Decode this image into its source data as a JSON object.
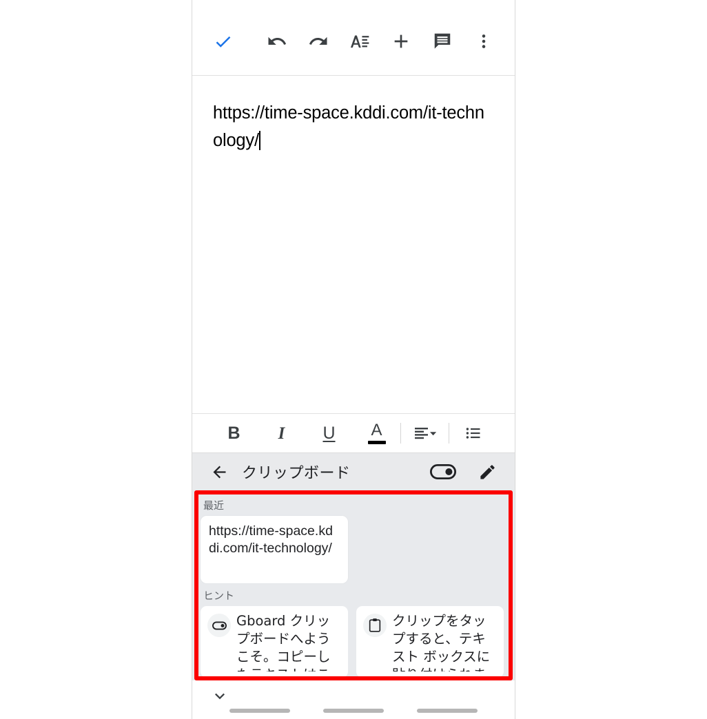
{
  "app": {
    "name": "Google Docs mobile editor with Gboard clipboard"
  },
  "top_toolbar": {
    "items": [
      {
        "name": "done-check",
        "label": "Done",
        "icon": "check-icon",
        "color": "#1a73e8"
      },
      {
        "name": "undo",
        "label": "Undo",
        "icon": "undo-icon"
      },
      {
        "name": "redo",
        "label": "Redo",
        "icon": "redo-icon"
      },
      {
        "name": "format",
        "label": "Format text",
        "icon": "text-format-icon"
      },
      {
        "name": "insert",
        "label": "Insert",
        "icon": "plus-icon"
      },
      {
        "name": "comment",
        "label": "Comment",
        "icon": "comment-icon"
      },
      {
        "name": "more",
        "label": "More options",
        "icon": "more-vertical-icon"
      }
    ]
  },
  "document": {
    "text": "https://time-space.kddi.com/it-technology/",
    "caret_visible": true
  },
  "format_toolbar": {
    "bold_label": "B",
    "italic_label": "I",
    "underline_label": "U",
    "text_color_label": "A",
    "align_label": "align-left",
    "list_label": "bulleted-list"
  },
  "clipboard": {
    "header": {
      "back_label": "back",
      "title": "クリップボード",
      "toggle_label": "クリップボードをオン",
      "toggle_state": "on",
      "edit_label": "編集"
    },
    "recent": {
      "section_label": "最近",
      "items": [
        {
          "text": "https://time-space.kddi.com/it-technology/"
        }
      ]
    },
    "hints": {
      "section_label": "ヒント",
      "items": [
        {
          "icon": "toggle-icon",
          "text": "Gboard クリップボードへようこそ。コピーしたテキストはこ"
        },
        {
          "icon": "clipboard-icon",
          "text": "クリップをタップすると、テキスト ボックスに貼り付けられま"
        }
      ]
    }
  },
  "bottom_bar": {
    "collapse_label": "閉じる",
    "nav_pills": [
      "pill-1",
      "pill-2",
      "pill-3"
    ]
  },
  "colors": {
    "accent_blue": "#1a73e8",
    "annotation_red": "#fb0000",
    "clipboard_bg": "#e8eaed",
    "header_bg": "#e9eaec",
    "icon_gray": "#3c4043"
  }
}
